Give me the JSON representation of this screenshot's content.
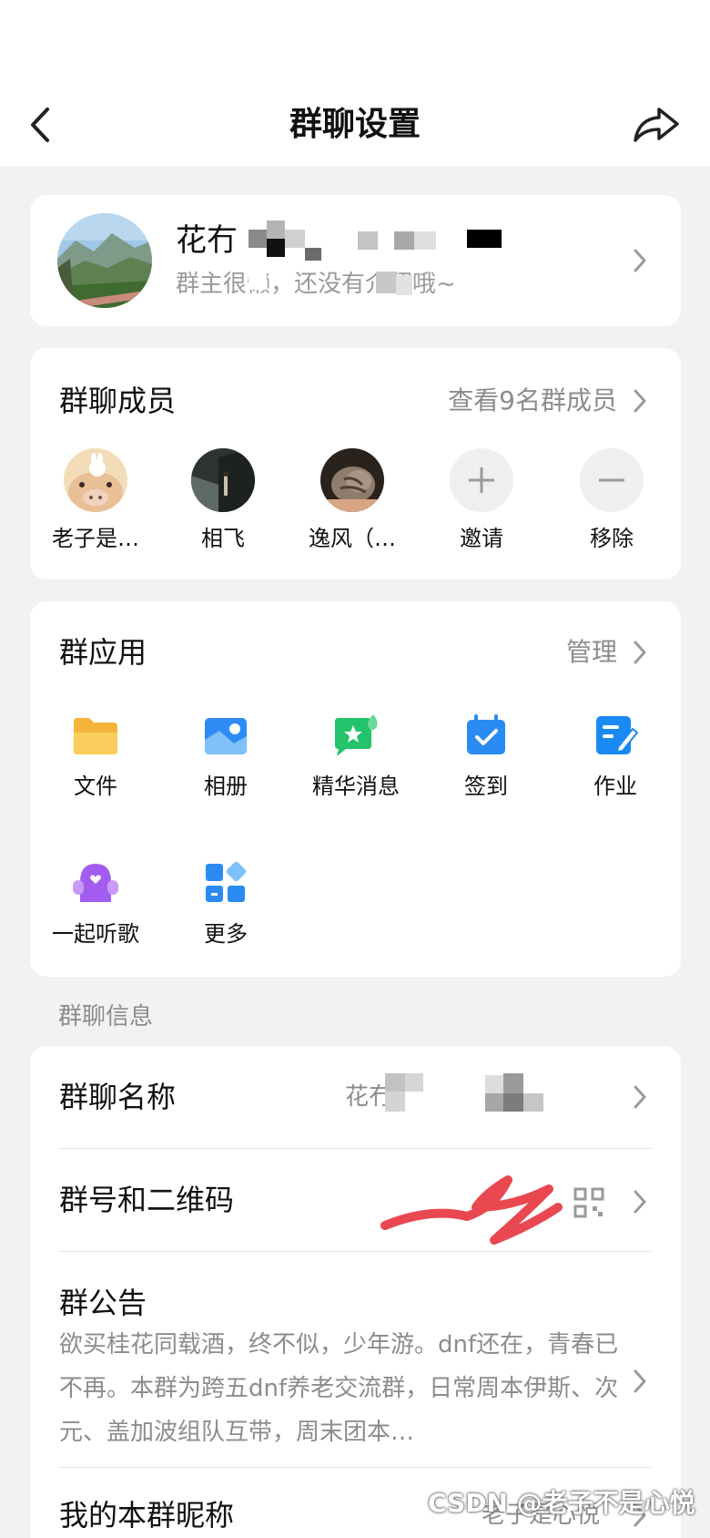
{
  "nav": {
    "title": "群聊设置",
    "back_icon": "chevron-left-icon",
    "share_icon": "share-icon"
  },
  "profile": {
    "name": "花冇",
    "description": "群主很懒，还没有介绍哦~"
  },
  "members": {
    "title": "群聊成员",
    "view_all": "查看9名群成员",
    "items": [
      {
        "name": "老子是…"
      },
      {
        "name": "相飞"
      },
      {
        "name": "逸风（…"
      },
      {
        "name": "邀请"
      },
      {
        "name": "移除"
      }
    ]
  },
  "apps": {
    "title": "群应用",
    "manage": "管理",
    "items": [
      {
        "label": "文件",
        "icon": "folder-icon",
        "color": "#f5b43a"
      },
      {
        "label": "相册",
        "icon": "album-icon",
        "color": "#2f8cf5"
      },
      {
        "label": "精华消息",
        "icon": "essence-message-icon",
        "color": "#22c36b"
      },
      {
        "label": "签到",
        "icon": "calendar-check-icon",
        "color": "#2a8cf2"
      },
      {
        "label": "作业",
        "icon": "homework-icon",
        "color": "#1a8af3"
      },
      {
        "label": "一起听歌",
        "icon": "listen-music-icon",
        "color": "#a25cf0"
      },
      {
        "label": "更多",
        "icon": "more-apps-icon",
        "color": "#2a8cf2"
      }
    ]
  },
  "info": {
    "section_label": "群聊信息",
    "group_name_label": "群聊名称",
    "group_name_value": "花冇",
    "group_id_label": "群号和二维码",
    "notice_label": "群公告",
    "notice_text": "欲买桂花同载酒，终不似，少年游。dnf还在，青春已不再。本群为跨五dnf养老交流群，日常周本伊斯、次元、盖加波组队互带，周末团本…",
    "nickname_label": "我的本群昵称",
    "nickname_value": "老子是心悦"
  },
  "watermark": "CSDN @老子不是心悦"
}
